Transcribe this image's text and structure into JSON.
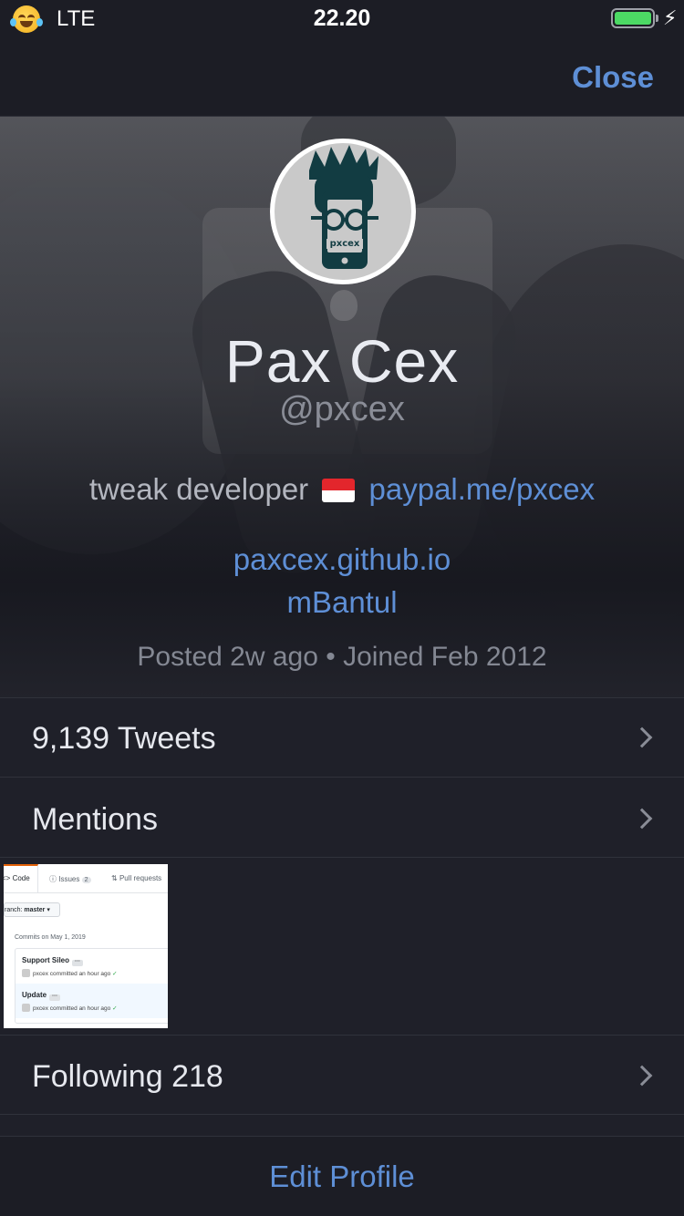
{
  "status_bar": {
    "emoji": "face-with-tears-of-joy-icon",
    "network": "LTE",
    "time": "22.20",
    "battery_level": 1.0,
    "charging": true
  },
  "nav": {
    "close_label": "Close"
  },
  "profile": {
    "name": "Pax Cex",
    "handle": "@pxcex",
    "bio_text": "tweak developer",
    "bio_flag": "indonesia-flag-icon",
    "bio_link": "paypal.me/pxcex",
    "website": "paxcex.github.io",
    "location": "mBantul",
    "meta": "Posted 2w ago • Joined Feb 2012",
    "avatar_text": "pxcex"
  },
  "list": {
    "tweets_label": "9,139 Tweets",
    "mentions_label": "Mentions",
    "following_label": "Following 218"
  },
  "media_thumbnail": {
    "tabs": [
      {
        "label": "<> Code"
      },
      {
        "label": "Issues",
        "badge": "2"
      },
      {
        "label": "Pull requests"
      }
    ],
    "branch_prefix": "ranch:",
    "branch_name": "master ▾",
    "commits_date": "Commits on May 1, 2019",
    "commits": [
      {
        "title": "Support Sileo",
        "sub": "pxcex committed an hour ago"
      },
      {
        "title": "Update",
        "sub": "pxcex committed an hour ago"
      }
    ]
  },
  "bottom": {
    "edit_profile_label": "Edit Profile"
  },
  "colors": {
    "accent": "#5e8fd6",
    "background": "#1f2029",
    "battery": "#4cd964"
  }
}
